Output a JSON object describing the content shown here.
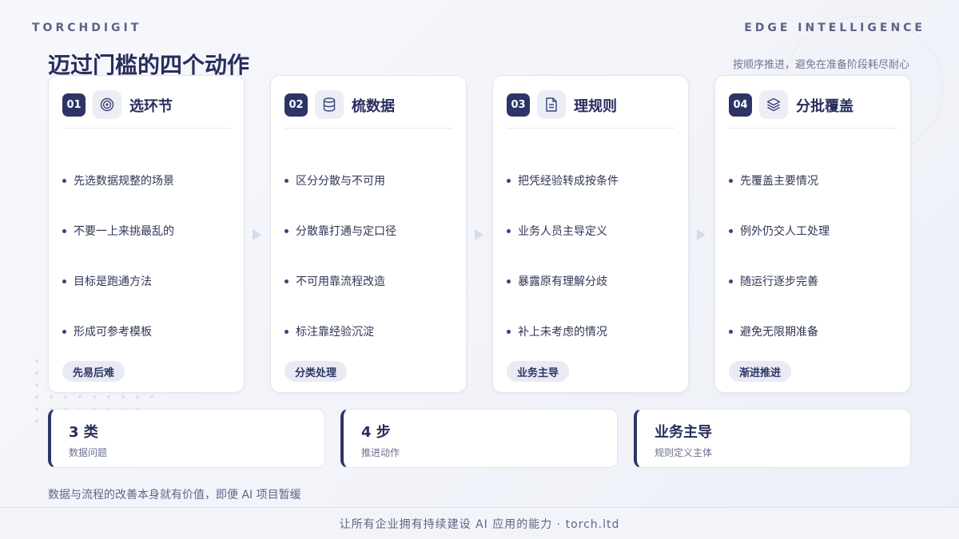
{
  "header": {
    "brand": "TORCHDIGIT",
    "brand_right": "EDGE INTELLIGENCE",
    "title": "迈过门槛的四个动作",
    "subtitle": "按顺序推进，避免在准备阶段耗尽耐心"
  },
  "cards": [
    {
      "num": "01",
      "icon": "target-icon",
      "title": "选环节",
      "items": [
        "先选数据规整的场景",
        "不要一上来挑最乱的",
        "目标是跑通方法",
        "形成可参考模板"
      ],
      "tag": "先易后难"
    },
    {
      "num": "02",
      "icon": "database-icon",
      "title": "梳数据",
      "items": [
        "区分分散与不可用",
        "分散靠打通与定口径",
        "不可用靠流程改造",
        "标注靠经验沉淀"
      ],
      "tag": "分类处理"
    },
    {
      "num": "03",
      "icon": "document-icon",
      "title": "理规则",
      "items": [
        "把凭经验转成按条件",
        "业务人员主导定义",
        "暴露原有理解分歧",
        "补上未考虑的情况"
      ],
      "tag": "业务主导"
    },
    {
      "num": "04",
      "icon": "layers-icon",
      "title": "分批覆盖",
      "items": [
        "先覆盖主要情况",
        "例外仍交人工处理",
        "随运行逐步完善",
        "避免无限期准备"
      ],
      "tag": "渐进推进"
    }
  ],
  "stats": [
    {
      "value": "3 类",
      "label": "数据问题"
    },
    {
      "value": "4 步",
      "label": "推进动作"
    },
    {
      "value": "业务主导",
      "label": "规则定义主体"
    }
  ],
  "note": "数据与流程的改善本身就有价值，即便 AI 项目暂缓",
  "footer": "让所有企业拥有持续建设 AI 应用的能力 · torch.ltd",
  "colors": {
    "accent": "#2c3566",
    "background": "#f3f4f9",
    "tag_bg": "#e8eaf4"
  }
}
